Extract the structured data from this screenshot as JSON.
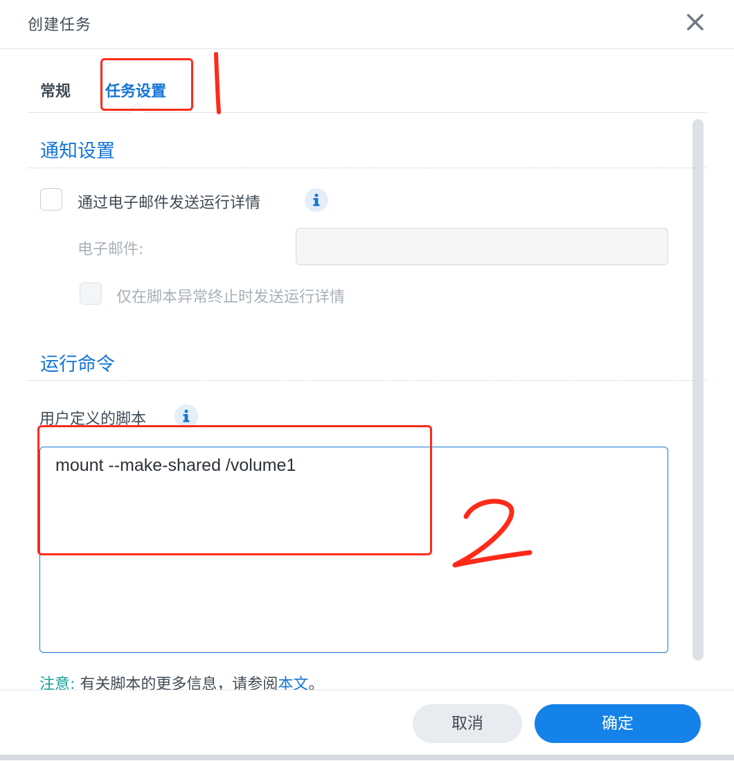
{
  "dialog": {
    "title": "创建任务",
    "close_icon": "close-icon"
  },
  "tabs": [
    {
      "label": "常规",
      "active": false
    },
    {
      "label": "任务设置",
      "active": true
    }
  ],
  "notification": {
    "section_title": "通知设置",
    "send_email_label": "通过电子邮件发送运行详情",
    "send_email_checked": false,
    "email_label": "电子邮件:",
    "email_value": "",
    "abnormal_only_label": "仅在脚本异常终止时发送运行详情",
    "abnormal_only_checked": false
  },
  "run_command": {
    "section_title": "运行命令",
    "script_label": "用户定义的脚本",
    "script_value": "mount --make-shared /volume1"
  },
  "note": {
    "prefix": "注意:",
    "text": "有关脚本的更多信息，请参阅",
    "link": "本文",
    "suffix": "。"
  },
  "footer": {
    "cancel_label": "取消",
    "ok_label": "确定"
  },
  "annotations": {
    "mark_1": "1",
    "mark_2": "2"
  },
  "colors": {
    "accent": "#1476d6",
    "primary_button": "#1482e8",
    "annotation_red": "#ff2a1a",
    "note_teal": "#14a196"
  }
}
